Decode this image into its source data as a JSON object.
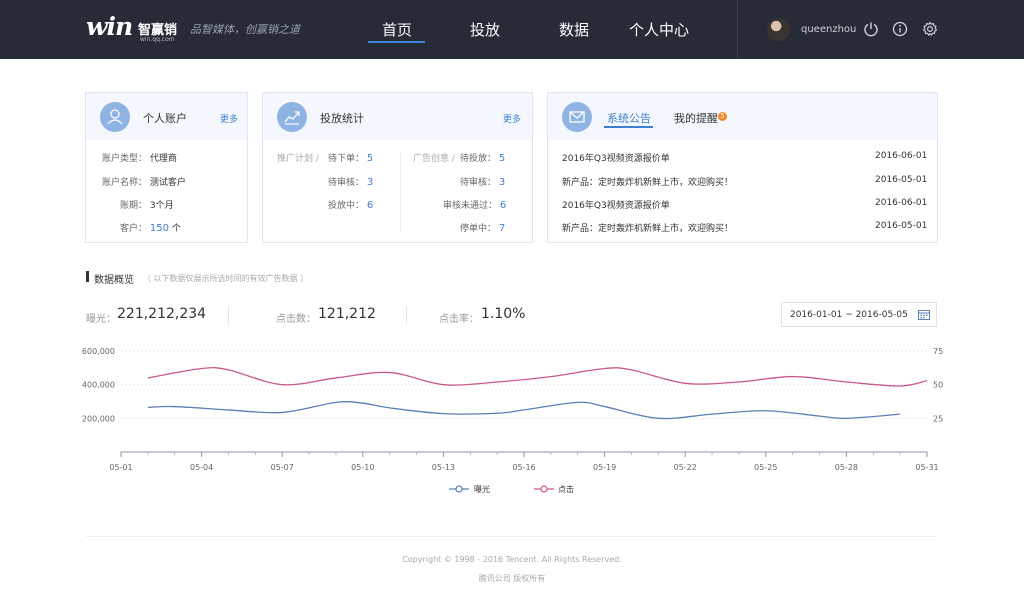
{
  "header": {
    "logo_text": "win",
    "logo_cn": "智赢销",
    "logo_url": "win.qq.com",
    "slogan": "品智媒体，创赢销之道",
    "nav": [
      "首页",
      "投放",
      "数据",
      "个人中心"
    ],
    "active_nav": 0,
    "username": "queenzhou",
    "icons": [
      "power-icon",
      "info-icon",
      "gear-icon"
    ]
  },
  "account_panel": {
    "title": "个人账户",
    "more": "更多",
    "rows": [
      {
        "label": "账户类型：",
        "value": "代理商"
      },
      {
        "label": "账户名称：",
        "value": "测试客户"
      },
      {
        "label": "账期：",
        "value": "3个月"
      },
      {
        "label": "客户：",
        "value": "150",
        "unit": "个"
      }
    ]
  },
  "ads_panel": {
    "title": "投放统计",
    "more": "更多",
    "left_group": "推广计划 /",
    "right_group": "广告创意 /",
    "left_rows": [
      {
        "label": "待下单：",
        "value": "5"
      },
      {
        "label": "待审核：",
        "value": "3"
      },
      {
        "label": "投放中：",
        "value": "6"
      }
    ],
    "right_rows": [
      {
        "label": "待投放：",
        "value": "5"
      },
      {
        "label": "待审核：",
        "value": "3"
      },
      {
        "label": "审核未通过：",
        "value": "6"
      },
      {
        "label": "停单中：",
        "value": "7"
      }
    ]
  },
  "notice_panel": {
    "tabs": [
      "系统公告",
      "我的提醒"
    ],
    "badge": "5",
    "items": [
      {
        "text": "2016年Q3视频资源报价单",
        "date": "2016-06-01"
      },
      {
        "text": "新产品：定时轰炸机新鲜上市，欢迎购买！",
        "date": "2016-05-01"
      },
      {
        "text": "2016年Q3视频资源报价单",
        "date": "2016-06-01"
      },
      {
        "text": "新产品：定时轰炸机新鲜上市，欢迎购买！",
        "date": "2016-05-01"
      }
    ]
  },
  "overview": {
    "title": "数据概览",
    "note": "（ 以下数据仅展示所选时间的有效广告数据 ）",
    "stats": [
      {
        "label": "曝光：",
        "value": "221,212,234"
      },
      {
        "label": "点击数：",
        "value": "121,212"
      },
      {
        "label": "点击率：",
        "value": "1.10%"
      }
    ],
    "date_range": "2016-01-01 ~ 2016-05-05"
  },
  "chart_data": {
    "type": "line",
    "x": [
      "05-01",
      "05-02",
      "05-03",
      "05-04",
      "05-05",
      "05-06",
      "05-07",
      "05-08",
      "05-09",
      "05-10",
      "05-11",
      "05-12",
      "05-13",
      "05-14",
      "05-15",
      "05-16",
      "05-17",
      "05-18",
      "05-19",
      "05-20",
      "05-21",
      "05-22",
      "05-23",
      "05-24",
      "05-25",
      "05-26",
      "05-27",
      "05-28",
      "05-29",
      "05-30",
      "05-31"
    ],
    "x_ticks": [
      "05-01",
      "05-04",
      "05-07",
      "05-10",
      "05-13",
      "05-16",
      "05-19",
      "05-22",
      "05-25",
      "05-28",
      "05-31"
    ],
    "y_left_ticks": [
      "600,000",
      "400,000",
      "200,000"
    ],
    "y_left_range": [
      0,
      600000
    ],
    "y_right_ticks": [
      "75",
      "50",
      "25"
    ],
    "y_right_range": [
      0,
      75
    ],
    "grid": true,
    "legend_position": "bottom",
    "series": [
      {
        "name": "曝光",
        "axis": "left",
        "color": "#5b7fb5",
        "x": [
          "05-02",
          "05-03",
          "05-05",
          "05-07",
          "05-09",
          "05-10",
          "05-11",
          "05-13",
          "05-15",
          "05-16",
          "05-18",
          "05-19",
          "05-21",
          "05-23",
          "05-25",
          "05-27",
          "05-28",
          "05-30"
        ],
        "values": [
          265000,
          270000,
          250000,
          235000,
          295000,
          290000,
          262000,
          228000,
          230000,
          250000,
          295000,
          270000,
          200000,
          225000,
          245000,
          213000,
          200000,
          225000
        ]
      },
      {
        "name": "点击",
        "axis": "right",
        "color": "#c9588f",
        "x": [
          "05-02",
          "05-04",
          "05-05",
          "05-07",
          "05-09",
          "05-11",
          "05-13",
          "05-15",
          "05-17",
          "05-19",
          "05-20",
          "05-22",
          "05-24",
          "05-26",
          "05-28",
          "05-30",
          "05-31"
        ],
        "values": [
          55,
          62,
          61,
          50,
          55,
          59,
          50,
          52,
          56,
          62,
          61,
          51,
          52,
          56,
          52,
          49,
          53
        ]
      }
    ]
  },
  "footer": {
    "copyright": "Copyright © 1998 - 2016 Tencent. All Rights Reserved.",
    "company": "腾讯公司 版权所有"
  }
}
